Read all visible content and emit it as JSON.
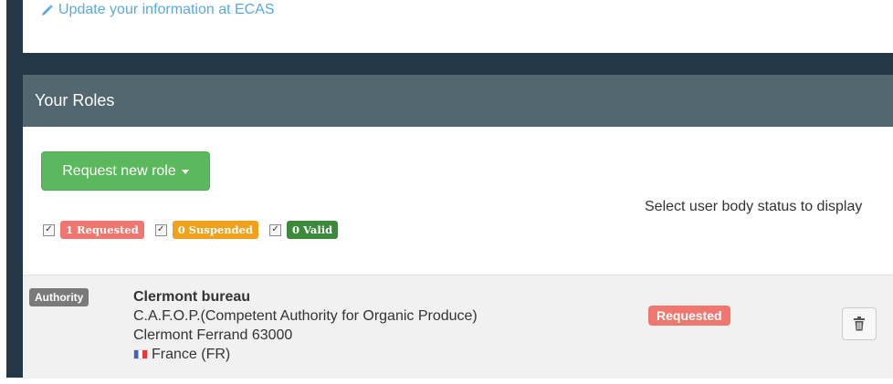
{
  "ecas_link": {
    "icon": "pencil-icon",
    "label": "Update your information at ECAS"
  },
  "roles_panel": {
    "title": "Your Roles",
    "request_button": {
      "label": "Request new role",
      "icon": "caret-down-icon"
    },
    "filter_label": "Select user body status to display",
    "filters": [
      {
        "checked": true,
        "label": "1 Requested",
        "color": "#f0776f"
      },
      {
        "checked": true,
        "label": "0 Suspended",
        "color": "#f0a21f"
      },
      {
        "checked": true,
        "label": "0 Valid",
        "color": "#3b8a3b"
      }
    ],
    "roles": [
      {
        "type": "Authority",
        "name": "Clermont bureau",
        "organisation": "C.A.F.O.P.(Competent Authority for Organic Produce)",
        "city": "Clermont Ferrand 63000",
        "country": "France (FR)",
        "country_flag": "france-flag-icon",
        "status": "Requested",
        "status_color": "#f0776f",
        "delete_icon": "trash-icon"
      }
    ]
  }
}
